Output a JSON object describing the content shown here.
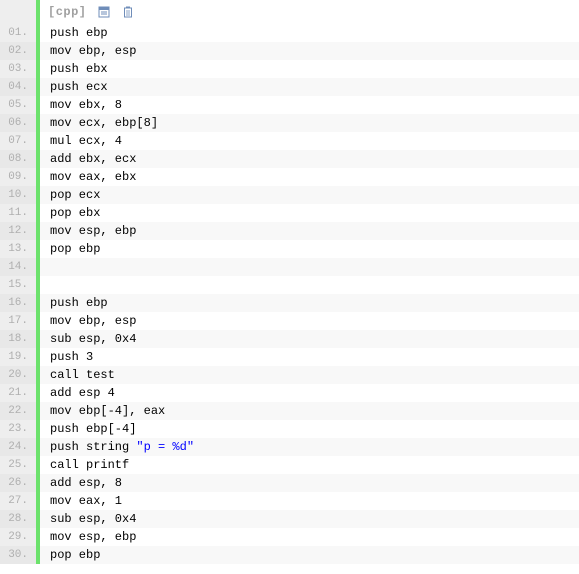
{
  "header": {
    "lang_label": "[cpp]",
    "view_icon_name": "view-plain-icon",
    "copy_icon_name": "copy-icon"
  },
  "code_lines": [
    {
      "num": "01.",
      "tokens": [
        {
          "t": "push ebp",
          "c": "plain"
        }
      ]
    },
    {
      "num": "02.",
      "tokens": [
        {
          "t": "mov ebp, esp",
          "c": "plain"
        }
      ]
    },
    {
      "num": "03.",
      "tokens": [
        {
          "t": "push ebx",
          "c": "plain"
        }
      ]
    },
    {
      "num": "04.",
      "tokens": [
        {
          "t": "push ecx",
          "c": "plain"
        }
      ]
    },
    {
      "num": "05.",
      "tokens": [
        {
          "t": "mov ebx, 8",
          "c": "plain"
        }
      ]
    },
    {
      "num": "06.",
      "tokens": [
        {
          "t": "mov ecx, ebp[8]",
          "c": "plain"
        }
      ]
    },
    {
      "num": "07.",
      "tokens": [
        {
          "t": "mul ecx, 4",
          "c": "plain"
        }
      ]
    },
    {
      "num": "08.",
      "tokens": [
        {
          "t": "add ebx, ecx",
          "c": "plain"
        }
      ]
    },
    {
      "num": "09.",
      "tokens": [
        {
          "t": "mov eax, ebx",
          "c": "plain"
        }
      ]
    },
    {
      "num": "10.",
      "tokens": [
        {
          "t": "pop ecx",
          "c": "plain"
        }
      ]
    },
    {
      "num": "11.",
      "tokens": [
        {
          "t": "pop ebx",
          "c": "plain"
        }
      ]
    },
    {
      "num": "12.",
      "tokens": [
        {
          "t": "mov esp, ebp",
          "c": "plain"
        }
      ]
    },
    {
      "num": "13.",
      "tokens": [
        {
          "t": "pop ebp",
          "c": "plain"
        }
      ]
    },
    {
      "num": "14.",
      "tokens": [
        {
          "t": "  ",
          "c": "plain"
        }
      ]
    },
    {
      "num": "15.",
      "tokens": [
        {
          "t": "  ",
          "c": "plain"
        }
      ]
    },
    {
      "num": "16.",
      "tokens": [
        {
          "t": "push ebp",
          "c": "plain"
        }
      ]
    },
    {
      "num": "17.",
      "tokens": [
        {
          "t": "mov ebp, esp",
          "c": "plain"
        }
      ]
    },
    {
      "num": "18.",
      "tokens": [
        {
          "t": "sub esp, 0x4",
          "c": "plain"
        }
      ]
    },
    {
      "num": "19.",
      "tokens": [
        {
          "t": "push 3",
          "c": "plain"
        }
      ]
    },
    {
      "num": "20.",
      "tokens": [
        {
          "t": "call test",
          "c": "plain"
        }
      ]
    },
    {
      "num": "21.",
      "tokens": [
        {
          "t": "add esp 4",
          "c": "plain"
        }
      ]
    },
    {
      "num": "22.",
      "tokens": [
        {
          "t": "mov ebp[-4], eax",
          "c": "plain"
        }
      ]
    },
    {
      "num": "23.",
      "tokens": [
        {
          "t": "push ebp[-4]",
          "c": "plain"
        }
      ]
    },
    {
      "num": "24.",
      "tokens": [
        {
          "t": "push string ",
          "c": "plain"
        },
        {
          "t": "\"p = %d\"",
          "c": "string"
        }
      ]
    },
    {
      "num": "25.",
      "tokens": [
        {
          "t": "call printf",
          "c": "plain"
        }
      ]
    },
    {
      "num": "26.",
      "tokens": [
        {
          "t": "add esp, 8",
          "c": "plain"
        }
      ]
    },
    {
      "num": "27.",
      "tokens": [
        {
          "t": "mov eax, 1",
          "c": "plain"
        }
      ]
    },
    {
      "num": "28.",
      "tokens": [
        {
          "t": "sub esp, 0x4",
          "c": "plain"
        }
      ]
    },
    {
      "num": "29.",
      "tokens": [
        {
          "t": "mov esp, ebp",
          "c": "plain"
        }
      ]
    },
    {
      "num": "30.",
      "tokens": [
        {
          "t": "pop ebp",
          "c": "plain"
        }
      ]
    }
  ]
}
